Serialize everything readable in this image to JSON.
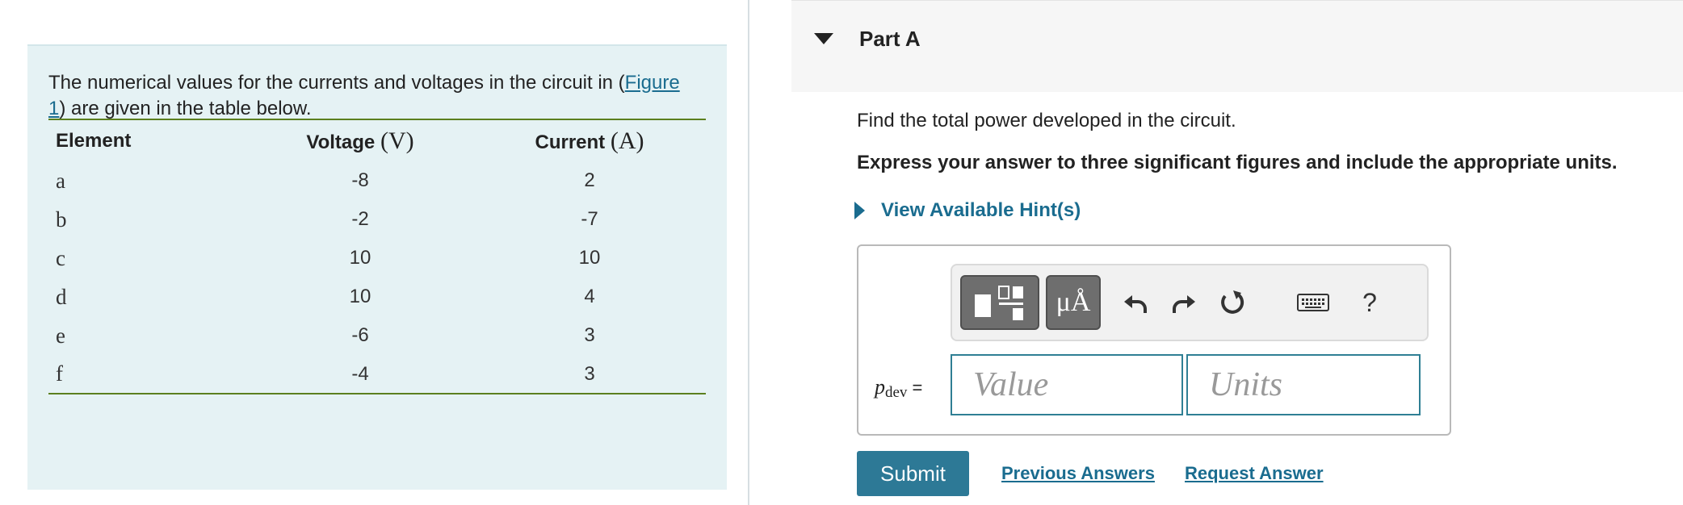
{
  "problem": {
    "intro_before": "The numerical values for the currents and voltages in the circuit in (",
    "figure_link": "Figure 1",
    "intro_after": ") are given in the table below.",
    "table": {
      "headers": [
        {
          "label": "Element",
          "unit": ""
        },
        {
          "label": "Voltage",
          "unit": "(V)"
        },
        {
          "label": "Current",
          "unit": "(A)"
        }
      ],
      "rows": [
        {
          "element": "a",
          "voltage": "-8",
          "current": "2"
        },
        {
          "element": "b",
          "voltage": "-2",
          "current": "-7"
        },
        {
          "element": "c",
          "voltage": "10",
          "current": "10"
        },
        {
          "element": "d",
          "voltage": "10",
          "current": "4"
        },
        {
          "element": "e",
          "voltage": "-6",
          "current": "3"
        },
        {
          "element": "f",
          "voltage": "-4",
          "current": "3"
        }
      ]
    }
  },
  "part": {
    "title": "Part A",
    "question": "Find the total power developed in the circuit.",
    "instruction": "Express your answer to three significant figures and include the appropriate units.",
    "hints_label": "View Available Hint(s)"
  },
  "answer": {
    "symbol": "p",
    "subscript": "dev",
    "equals": "=",
    "value_placeholder": "Value",
    "units_placeholder": "Units",
    "toolbar": {
      "units_button": "μÅ",
      "help": "?"
    }
  },
  "actions": {
    "submit": "Submit",
    "previous_answers": "Previous Answers",
    "request_answer": "Request Answer"
  },
  "colors": {
    "panel_bg": "#e5f2f4",
    "link": "#1a6c8f",
    "submit_bg": "#2d7996",
    "table_rule": "#5b7f1e"
  }
}
